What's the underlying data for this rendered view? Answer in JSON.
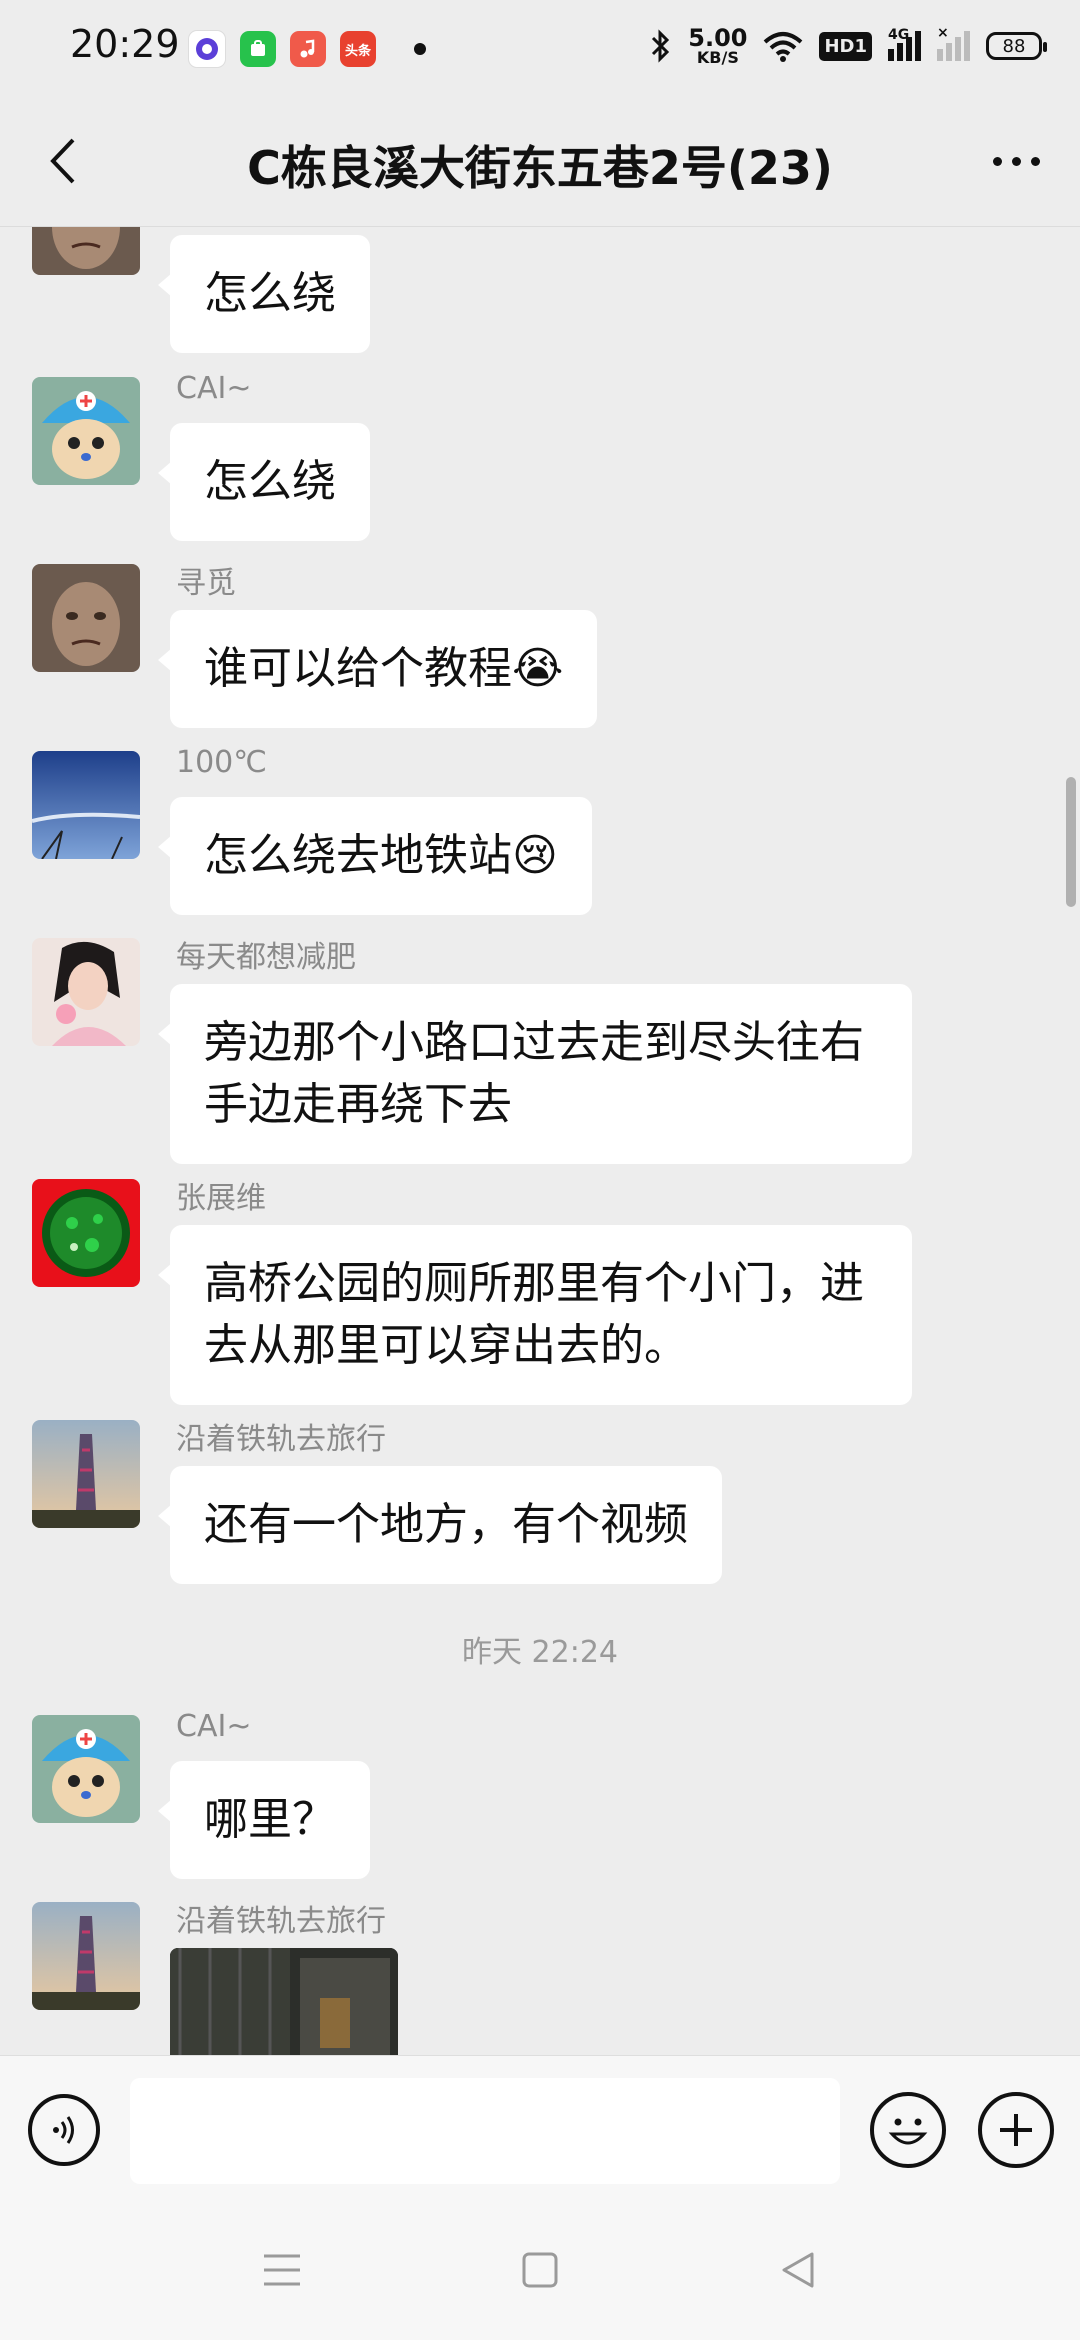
{
  "status_bar": {
    "time": "20:29",
    "net_speed_value": "5.00",
    "net_speed_unit": "KB/S",
    "hd_label": "HD1",
    "network_type": "4G",
    "battery_level": "88",
    "app_icons": [
      {
        "icon": "browser-app-icon",
        "color": "#5b3fd8"
      },
      {
        "icon": "market-app-icon",
        "color": "#27c24c"
      },
      {
        "icon": "music-app-icon",
        "color": "#f05a4a"
      },
      {
        "icon": "toutiao-app-icon",
        "color": "#e8412f",
        "label": "头条"
      }
    ]
  },
  "header": {
    "title": "C栋良溪大街东五巷2号(23)"
  },
  "messages": [
    {
      "sender": "",
      "text": "怎么绕",
      "avatar": "avatar-muddy-face"
    },
    {
      "sender": "CAI~",
      "text": "怎么绕",
      "avatar": "avatar-chopper-cat"
    },
    {
      "sender": "寻觅",
      "text": "谁可以给个教程😭",
      "avatar": "avatar-muddy-face"
    },
    {
      "sender": "100℃",
      "text": "怎么绕去地铁站😢",
      "avatar": "avatar-sky"
    },
    {
      "sender": "每天都想减肥",
      "text": "旁边那个小路口过去走到尽头往右手边走再绕下去",
      "avatar": "avatar-girl"
    },
    {
      "sender": "张展维",
      "text": "高桥公园的厕所那里有个小门，进去从那里可以穿出去的。",
      "avatar": "avatar-red-green"
    },
    {
      "sender": "沿着铁轨去旅行",
      "text": "还有一个地方，有个视频",
      "avatar": "avatar-tower"
    },
    {
      "sender": "CAI~",
      "text": "哪里？",
      "avatar": "avatar-chopper-cat"
    },
    {
      "sender": "沿着铁轨去旅行",
      "text": "",
      "avatar": "avatar-tower",
      "type": "video"
    }
  ],
  "time_divider": "昨天 22:24",
  "input": {
    "placeholder": "",
    "value": ""
  },
  "colors": {
    "background": "#ededed",
    "bubble": "#ffffff",
    "sender_name": "#8a8a8a"
  }
}
